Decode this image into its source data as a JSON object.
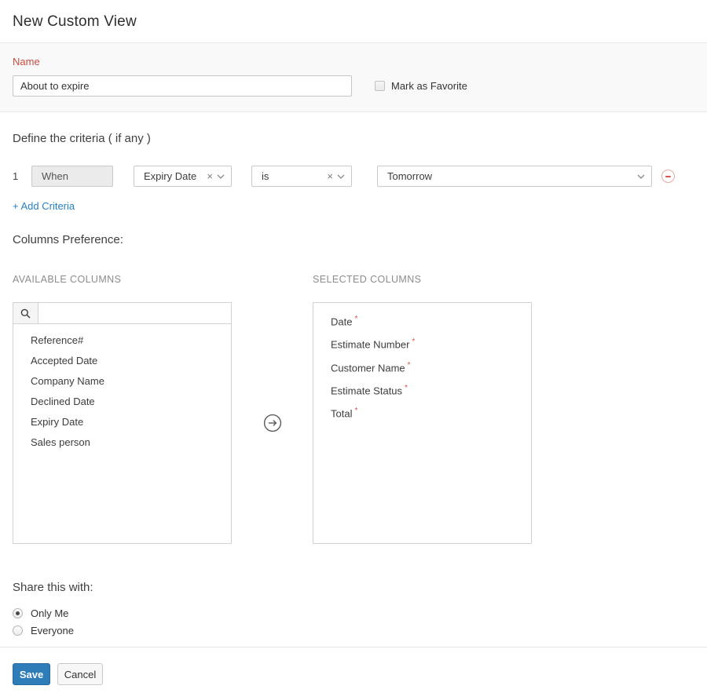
{
  "header": {
    "title": "New Custom View"
  },
  "name_section": {
    "label": "Name",
    "value": "About to expire",
    "favorite_label": "Mark as Favorite",
    "favorite_checked": false
  },
  "criteria": {
    "heading": "Define the criteria ( if any )",
    "row_number": "1",
    "when_label": "When",
    "field_value": "Expiry Date",
    "comparator_value": "is",
    "value_value": "Tomorrow",
    "add_link": "+ Add Criteria"
  },
  "columns": {
    "heading": "Columns Preference:",
    "available_label": "AVAILABLE COLUMNS",
    "selected_label": "SELECTED COLUMNS",
    "search_placeholder": "",
    "search_value": "",
    "available": [
      "Reference#",
      "Accepted Date",
      "Company Name",
      "Declined Date",
      "Expiry Date",
      "Sales person"
    ],
    "selected": [
      "Date",
      "Estimate Number",
      "Customer Name",
      "Estimate Status",
      "Total"
    ],
    "required_marker": "*"
  },
  "share": {
    "heading": "Share this with:",
    "options": [
      {
        "label": "Only Me",
        "selected": true
      },
      {
        "label": "Everyone",
        "selected": false
      }
    ]
  },
  "footer": {
    "save_label": "Save",
    "cancel_label": "Cancel"
  },
  "icons": {
    "clear_glyph": "×",
    "search_icon": "magnifier",
    "dropdown_icon": "chevron-down",
    "move_icon": "arrow-right-circle",
    "remove_icon": "minus-circle"
  },
  "colors": {
    "accent_blue": "#2e7cb8",
    "label_red": "#ca4a3f",
    "link_blue": "#2781c4",
    "required_red": "#d9534f",
    "remove_red": "#e9aaa4"
  }
}
